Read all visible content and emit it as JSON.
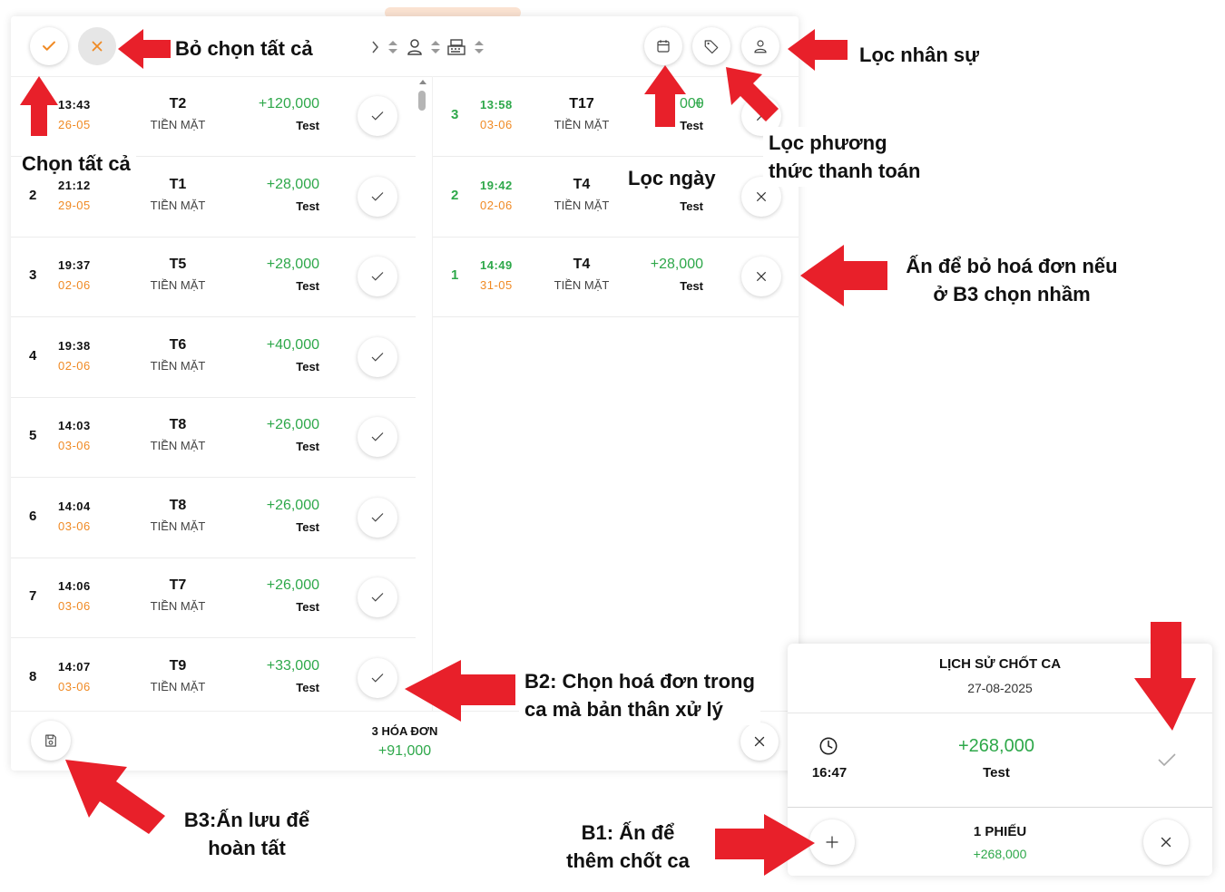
{
  "toolbar": {
    "select_all_icon": "check-icon",
    "deselect_all_icon": "x-icon",
    "sort_icons": [
      "chevron-right-icon",
      "sort-icon",
      "user-icon",
      "sort-icon",
      "cash-register-icon",
      "sort-icon"
    ],
    "filter_icons": [
      "calendar-icon",
      "tag-icon",
      "user-icon"
    ]
  },
  "left_list": [
    {
      "num": "",
      "time": "13:43",
      "date": "26-05",
      "table": "T2",
      "payment": "TIỀN MẶT",
      "amount": "+120,000",
      "staff": "Test"
    },
    {
      "num": "2",
      "time": "21:12",
      "date": "29-05",
      "table": "T1",
      "payment": "TIỀN MẶT",
      "amount": "+28,000",
      "staff": "Test"
    },
    {
      "num": "3",
      "time": "19:37",
      "date": "02-06",
      "table": "T5",
      "payment": "TIỀN MẶT",
      "amount": "+28,000",
      "staff": "Test"
    },
    {
      "num": "4",
      "time": "19:38",
      "date": "02-06",
      "table": "T6",
      "payment": "TIỀN MẶT",
      "amount": "+40,000",
      "staff": "Test"
    },
    {
      "num": "5",
      "time": "14:03",
      "date": "03-06",
      "table": "T8",
      "payment": "TIỀN MẶT",
      "amount": "+26,000",
      "staff": "Test"
    },
    {
      "num": "6",
      "time": "14:04",
      "date": "03-06",
      "table": "T8",
      "payment": "TIỀN MẶT",
      "amount": "+26,000",
      "staff": "Test"
    },
    {
      "num": "7",
      "time": "14:06",
      "date": "03-06",
      "table": "T7",
      "payment": "TIỀN MẶT",
      "amount": "+26,000",
      "staff": "Test"
    },
    {
      "num": "8",
      "time": "14:07",
      "date": "03-06",
      "table": "T9",
      "payment": "TIỀN MẶT",
      "amount": "+33,000",
      "staff": "Test"
    }
  ],
  "right_list": [
    {
      "num": "3",
      "time": "13:58",
      "date": "03-06",
      "table": "T17",
      "payment": "TIỀN MẶT",
      "amount": "+",
      "amount_tail": "000",
      "staff": "Test"
    },
    {
      "num": "2",
      "time": "19:42",
      "date": "02-06",
      "table": "T4",
      "payment": "TIỀN MẶT",
      "amount": "",
      "staff": "Test"
    },
    {
      "num": "1",
      "time": "14:49",
      "date": "31-05",
      "table": "T4",
      "payment": "TIỀN MẶT",
      "amount": "+28,000",
      "staff": "Test"
    }
  ],
  "footer": {
    "count_label": "3 HÓA ĐƠN",
    "total": "+91,000"
  },
  "history": {
    "title": "LỊCH SỬ CHỐT CA",
    "date": "27-08-2025",
    "entry_time": "16:47",
    "entry_amount": "+268,000",
    "entry_staff": "Test",
    "footer_count": "1 PHIẾU",
    "footer_total": "+268,000"
  },
  "annotations": {
    "deselect_all": "Bỏ chọn tất cả",
    "select_all": "Chọn tất cả",
    "filter_staff": "Lọc nhân sự",
    "filter_payment_1": "Lọc phương",
    "filter_payment_2": "thức thanh toán",
    "filter_date": "Lọc ngày",
    "remove_1": "Ấn để bỏ hoá đơn nếu",
    "remove_2": "ở B3 chọn nhầm",
    "b2_1": "B2: Chọn hoá đơn trong",
    "b2_2": "ca mà bản thân xử lý",
    "b3_1": "B3:Ấn lưu để",
    "b3_2": "hoàn tất",
    "b1_1": "B1: Ấn để",
    "b1_2": "thêm chốt ca"
  },
  "colors": {
    "accent_orange": "#f08a24",
    "green": "#2ea84a",
    "arrow_red": "#e8202a"
  }
}
